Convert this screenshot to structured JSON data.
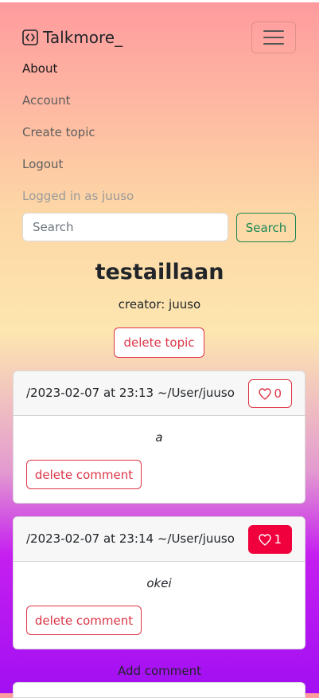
{
  "navbar": {
    "brand": "Talkmore_",
    "items": [
      {
        "label": "About"
      },
      {
        "label": "Account"
      },
      {
        "label": "Create topic"
      },
      {
        "label": "Logout"
      }
    ],
    "logged_in_text": "Logged in as juuso"
  },
  "search": {
    "placeholder": "Search",
    "button_label": "Search"
  },
  "topic": {
    "title": "testaillaan",
    "creator": "creator: juuso",
    "delete_label": "delete topic"
  },
  "comments": [
    {
      "meta": "/2023-02-07 at 23:13 ~/User/juuso",
      "likes": "0",
      "liked": false,
      "text": "a",
      "delete_label": "delete comment"
    },
    {
      "meta": "/2023-02-07 at 23:14 ~/User/juuso",
      "likes": "1",
      "liked": true,
      "text": "okei",
      "delete_label": "delete comment"
    }
  ],
  "add_comment_label": "Add comment",
  "colors": {
    "danger": "#dc3545",
    "success": "#198754",
    "liked": "#f0003c"
  }
}
